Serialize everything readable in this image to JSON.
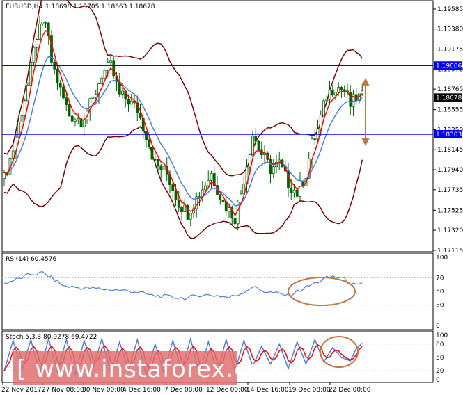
{
  "header": {
    "symbol_label": "EURUSD,H4",
    "ohlc": "1.18698 1.18705 1.18663 1.18678"
  },
  "main_panel": {
    "price_ticks": [
      "1.19585",
      "1.19380",
      "1.19175",
      "1.18970",
      "1.18765",
      "1.18555",
      "1.18350",
      "1.18145",
      "1.17940",
      "1.17735",
      "1.17525",
      "1.17320",
      "1.17115"
    ],
    "levels": [
      {
        "label": "1.19006",
        "value": 1.19006
      },
      {
        "label": "1.18303",
        "value": 1.18303
      }
    ],
    "current_price_label": "1.18678",
    "current_price": 1.18678
  },
  "rsi_panel": {
    "label": "RSI(14) 60.4576",
    "ticks": [
      "100",
      "70",
      "50",
      "30",
      "0"
    ]
  },
  "stoch_panel": {
    "label": "Stoch 5,3,3 80.9278 69.4722",
    "ticks": [
      "100",
      "80",
      "50",
      "20",
      "0"
    ]
  },
  "time_axis": [
    "22 Nov 2017",
    "27 Nov 08:00",
    "30 Nov 00:00",
    "4 Dec 16:00",
    "7 Dec 08:00",
    "12 Dec 00:00",
    "14 Dec 16:00",
    "19 Dec 08:00",
    "22 Dec 00:00"
  ],
  "watermark": "[ www.instaforex.com ]",
  "colors": {
    "background": "#ffffff",
    "candle": "#006400",
    "level_line": "#0000ff",
    "bollinger": "#800000",
    "ma_fast": "#ff0000",
    "ma_slow": "#4a7fe0",
    "annotation": "#c07848",
    "stoch_signal": "#ff0000",
    "stoch_main": "#4a7fe0",
    "watermark_band": "#e07070"
  },
  "chart_data": {
    "type": "candlestick",
    "symbol": "EURUSD",
    "timeframe": "H4",
    "ylim": [
      1.171,
      1.1967
    ],
    "reference_levels": [
      1.19006,
      1.18303
    ],
    "anchors": [
      [
        0,
        1.1785
      ],
      [
        3,
        1.1815
      ],
      [
        8,
        1.188
      ],
      [
        11,
        1.1932
      ],
      [
        14,
        1.1945
      ],
      [
        16,
        1.1905
      ],
      [
        19,
        1.1875
      ],
      [
        22,
        1.185
      ],
      [
        26,
        1.1845
      ],
      [
        30,
        1.1865
      ],
      [
        33,
        1.1892
      ],
      [
        36,
        1.19
      ],
      [
        39,
        1.187
      ],
      [
        42,
        1.1865
      ],
      [
        45,
        1.1855
      ],
      [
        48,
        1.183
      ],
      [
        51,
        1.18
      ],
      [
        55,
        1.179
      ],
      [
        59,
        1.176
      ],
      [
        62,
        1.175
      ],
      [
        66,
        1.177
      ],
      [
        70,
        1.179
      ],
      [
        74,
        1.176
      ],
      [
        78,
        1.1745
      ],
      [
        80,
        1.177
      ],
      [
        84,
        1.183
      ],
      [
        87,
        1.181
      ],
      [
        90,
        1.1795
      ],
      [
        93,
        1.18
      ],
      [
        96,
        1.178
      ],
      [
        99,
        1.177
      ],
      [
        102,
        1.179
      ],
      [
        104,
        1.182
      ],
      [
        106,
        1.1835
      ],
      [
        109,
        1.187
      ],
      [
        112,
        1.188
      ],
      [
        115,
        1.1875
      ],
      [
        117,
        1.186
      ],
      [
        119,
        1.1868
      ],
      [
        121,
        1.1868
      ]
    ],
    "rsi_anchors": [
      [
        0,
        62
      ],
      [
        4,
        67
      ],
      [
        9,
        75
      ],
      [
        13,
        77
      ],
      [
        16,
        70
      ],
      [
        20,
        58
      ],
      [
        26,
        55
      ],
      [
        32,
        54
      ],
      [
        38,
        52
      ],
      [
        44,
        50
      ],
      [
        50,
        44
      ],
      [
        56,
        42
      ],
      [
        62,
        40
      ],
      [
        66,
        45
      ],
      [
        72,
        44
      ],
      [
        76,
        41
      ],
      [
        80,
        47
      ],
      [
        84,
        57
      ],
      [
        88,
        50
      ],
      [
        92,
        47
      ],
      [
        96,
        44
      ],
      [
        100,
        52
      ],
      [
        104,
        60
      ],
      [
        108,
        68
      ],
      [
        111,
        72
      ],
      [
        114,
        70
      ],
      [
        117,
        62
      ],
      [
        119,
        58
      ],
      [
        121,
        60
      ]
    ],
    "stoch_anchors": [
      [
        0,
        20
      ],
      [
        3,
        88
      ],
      [
        6,
        22
      ],
      [
        9,
        90
      ],
      [
        12,
        15
      ],
      [
        15,
        92
      ],
      [
        18,
        18
      ],
      [
        21,
        90
      ],
      [
        24,
        12
      ],
      [
        27,
        88
      ],
      [
        30,
        25
      ],
      [
        33,
        92
      ],
      [
        36,
        15
      ],
      [
        39,
        85
      ],
      [
        42,
        20
      ],
      [
        45,
        90
      ],
      [
        48,
        10
      ],
      [
        51,
        80
      ],
      [
        54,
        15
      ],
      [
        57,
        88
      ],
      [
        60,
        20
      ],
      [
        63,
        92
      ],
      [
        66,
        12
      ],
      [
        69,
        85
      ],
      [
        72,
        15
      ],
      [
        75,
        90
      ],
      [
        78,
        20
      ],
      [
        81,
        88
      ],
      [
        84,
        30
      ],
      [
        87,
        75
      ],
      [
        90,
        35
      ],
      [
        93,
        80
      ],
      [
        96,
        25
      ],
      [
        99,
        85
      ],
      [
        102,
        35
      ],
      [
        105,
        90
      ],
      [
        108,
        40
      ],
      [
        111,
        72
      ],
      [
        114,
        50
      ],
      [
        117,
        42
      ],
      [
        119,
        70
      ],
      [
        121,
        82
      ]
    ]
  }
}
